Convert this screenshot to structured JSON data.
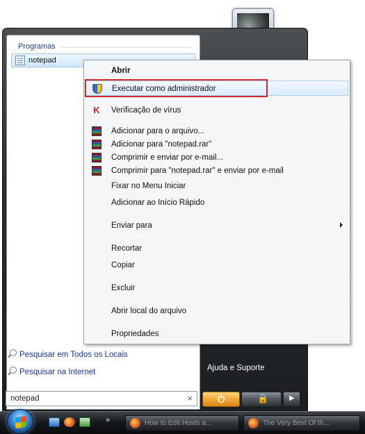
{
  "start_menu": {
    "group_header": "Programas",
    "program_item": "notepad",
    "search_links": [
      "Pesquisar em Todos os Locais",
      "Pesquisar na Internet"
    ],
    "search_query": "notepad",
    "clear_symbol": "×",
    "right_links": {
      "help": "Ajuda e Suporte"
    },
    "power_symbol": "⏻",
    "lock_symbol": "🔒",
    "arrow_symbol": "▶"
  },
  "context_menu": {
    "items": [
      {
        "label": "Abrir",
        "bold": true
      },
      {
        "label": "Executar como administrador",
        "icon": "uac-shield-icon",
        "highlighted": true
      },
      {
        "label": "Verificação de vírus",
        "icon": "kaspersky-icon"
      },
      {
        "label": "Adicionar para o arquivo...",
        "icon": "winrar-icon"
      },
      {
        "label": "Adicionar para \"notepad.rar\"",
        "icon": "winrar-icon"
      },
      {
        "label": "Comprimir e enviar por e-mail...",
        "icon": "winrar-icon"
      },
      {
        "label": "Comprimir para \"notepad.rar\" e enviar por e-mail",
        "icon": "winrar-icon"
      },
      {
        "label": "Fixar no Menu Iniciar"
      },
      {
        "label": "Adicionar ao Início Rápido"
      },
      {
        "label": "Enviar para",
        "submenu": true
      },
      {
        "label": "Recortar"
      },
      {
        "label": "Copiar"
      },
      {
        "label": "Excluir"
      },
      {
        "label": "Abrir local do arquivo"
      },
      {
        "label": "Propriedades"
      }
    ],
    "highlight_color": "#d12a2a"
  },
  "taskbar": {
    "chevron": "»",
    "buttons": [
      {
        "label": "How to Edit Hosts a..."
      },
      {
        "label": "The Very Best Of th..."
      }
    ]
  }
}
